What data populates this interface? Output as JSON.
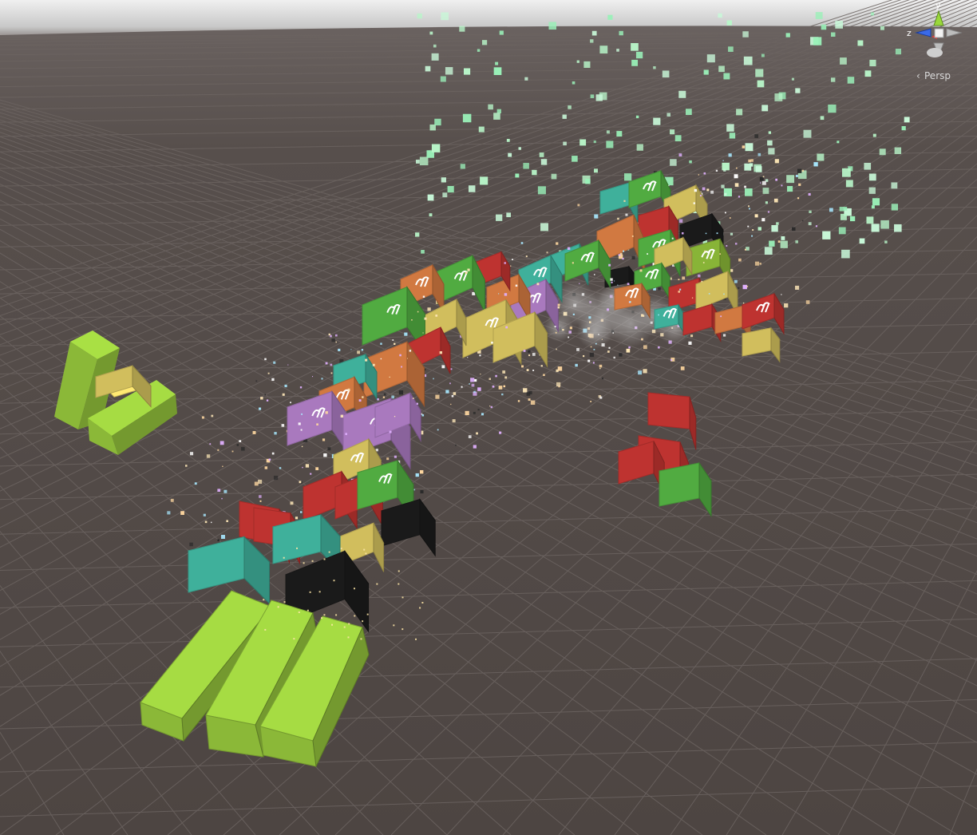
{
  "scene": {
    "background": "#4f4744",
    "sky_color": "#d8d8d8",
    "grid_color": "#6a625e"
  },
  "gizmo": {
    "y_label": "y",
    "z_label": "z",
    "y_color": "#9ad83a",
    "z_color": "#3a6ae8",
    "x_color": "#e83a3a"
  },
  "view": {
    "projection_label": "Persp"
  },
  "blocks": {
    "lime": "#9acc3e",
    "green": "#5cc24a",
    "teal": "#48c8b0",
    "yellow": "#eed86a",
    "orange": "#ee8a4a",
    "red": "#d83a36",
    "purple": "#c08ad8",
    "black": "#1e1e1e"
  }
}
